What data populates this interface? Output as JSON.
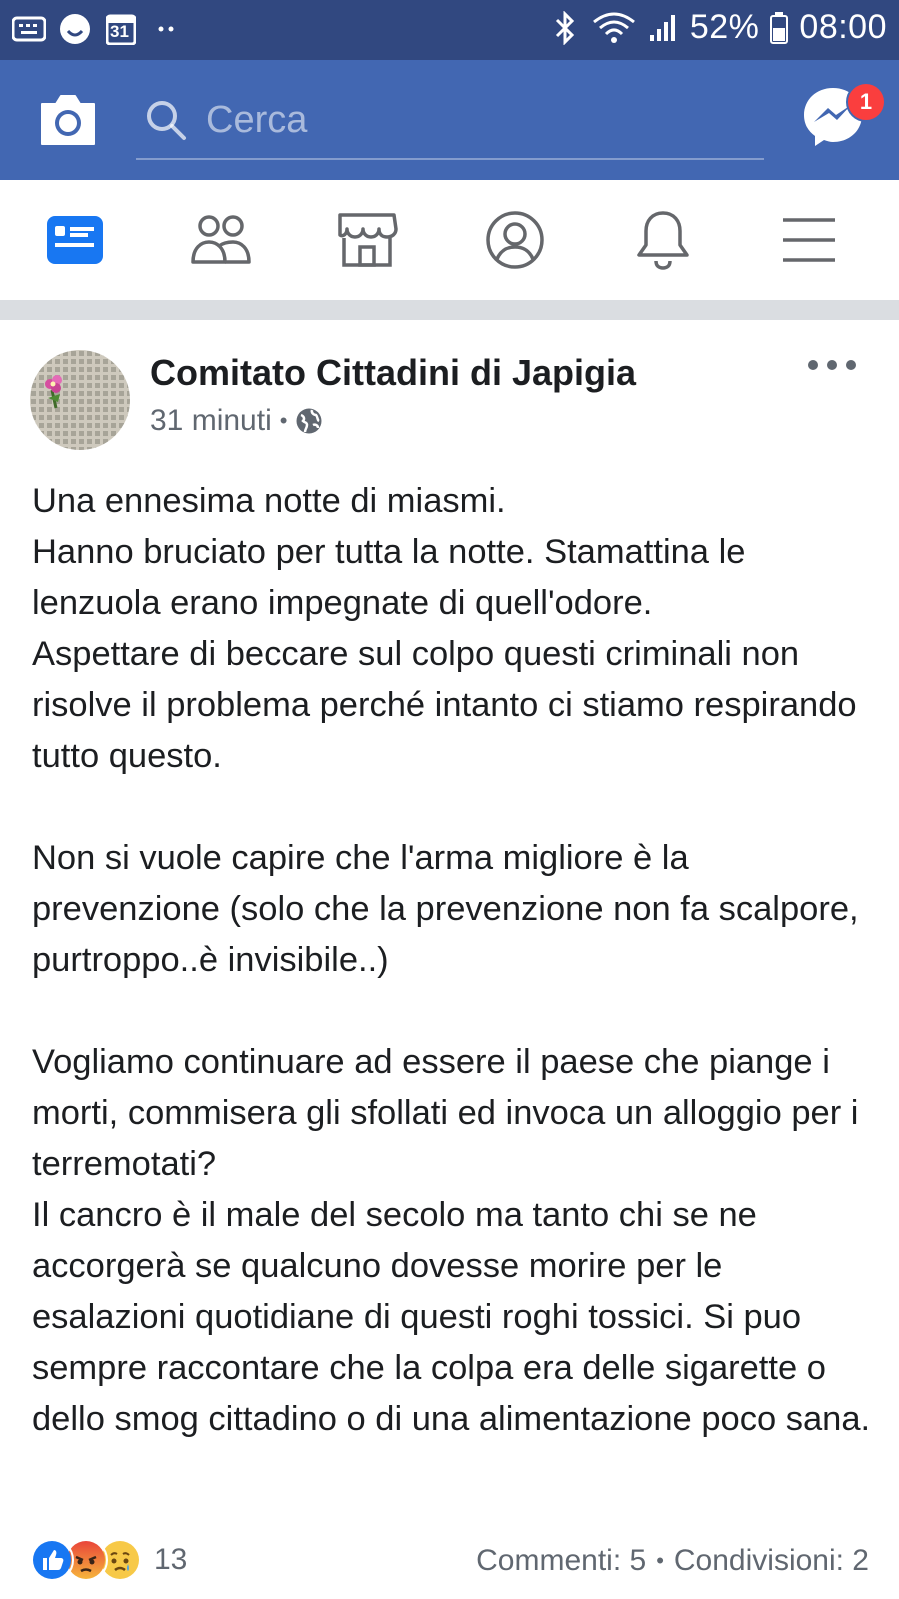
{
  "status_bar": {
    "left_icons": [
      "keyboard-icon",
      "smiley-icon",
      "calendar-icon",
      "dots-icon"
    ],
    "calendar_day": "31",
    "battery_percent": "52%",
    "time": "08:00"
  },
  "header": {
    "search_placeholder": "Cerca",
    "messenger_badge": "1"
  },
  "tabs": [
    "news-feed",
    "friends",
    "marketplace",
    "profile",
    "notifications",
    "menu"
  ],
  "post": {
    "page_name": "Comitato Cittadini di Japigia",
    "time": "31 minuti",
    "separator": "•",
    "paragraphs": [
      "Una ennesima notte di miasmi.\nHanno bruciato per tutta la notte. Stamattina le lenzuola erano impegnate di quell'odore.\nAspettare di beccare sul colpo questi criminali non risolve il problema perché intanto ci stiamo respirando tutto questo.",
      "Non si vuole capire che l'arma migliore è la prevenzione (solo che la prevenzione non fa scalpore, purtroppo..è invisibile..)",
      "Vogliamo continuare ad essere il paese che piange i morti, commisera gli sfollati ed invoca un alloggio per i terremotati?\nIl cancro è il male del secolo ma tanto chi se ne accorgerà se qualcuno dovesse morire per le esalazioni quotidiane di questi roghi tossici. Si puo sempre raccontare che la colpa era delle sigarette o dello smog cittadino o di una alimentazione poco sana."
    ],
    "reaction_count": "13",
    "comments": "Commenti: 5",
    "shares": "Condivisioni: 2"
  },
  "colors": {
    "status_bar": "#314880",
    "header": "#4267b2",
    "active_tab": "#1877f2",
    "inactive_tab": "#65676b"
  }
}
